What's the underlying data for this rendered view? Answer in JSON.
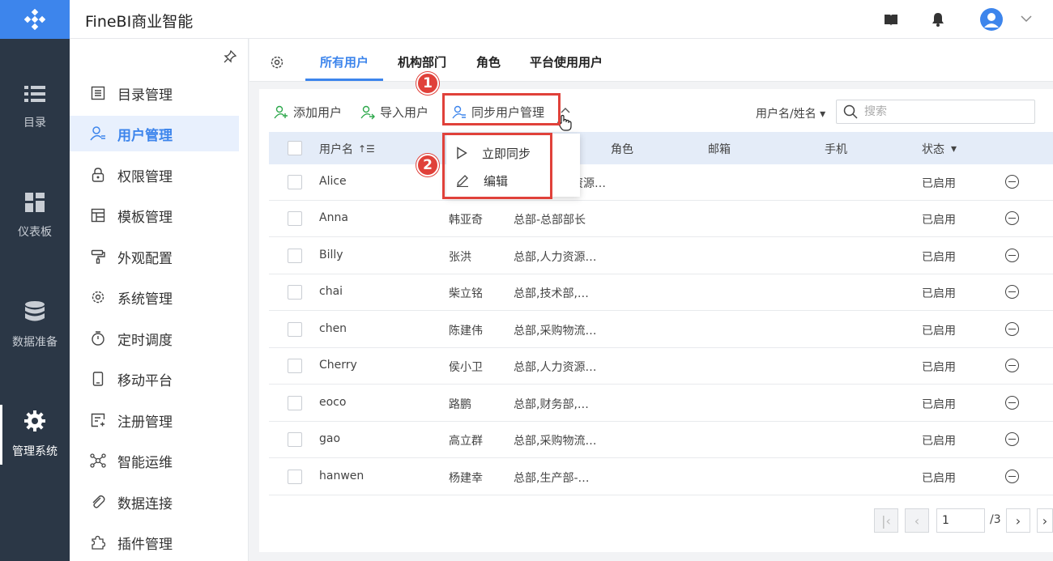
{
  "app": {
    "title": "FineBI商业智能"
  },
  "rail": {
    "items": [
      {
        "label": "目录",
        "icon": "list-icon"
      },
      {
        "label": "仪表板",
        "icon": "dashboard-icon"
      },
      {
        "label": "数据准备",
        "icon": "database-icon"
      },
      {
        "label": "管理系统",
        "icon": "gear-icon"
      }
    ]
  },
  "sidebar": {
    "items": [
      {
        "label": "目录管理",
        "icon": "catalog-icon"
      },
      {
        "label": "用户管理",
        "icon": "user-icon"
      },
      {
        "label": "权限管理",
        "icon": "lock-icon"
      },
      {
        "label": "模板管理",
        "icon": "template-icon"
      },
      {
        "label": "外观配置",
        "icon": "paint-roller-icon"
      },
      {
        "label": "系统管理",
        "icon": "settings-icon"
      },
      {
        "label": "定时调度",
        "icon": "timer-icon"
      },
      {
        "label": "移动平台",
        "icon": "mobile-icon"
      },
      {
        "label": "注册管理",
        "icon": "register-icon"
      },
      {
        "label": "智能运维",
        "icon": "network-icon"
      },
      {
        "label": "数据连接",
        "icon": "paperclip-icon"
      },
      {
        "label": "插件管理",
        "icon": "puzzle-icon"
      }
    ]
  },
  "tabs": [
    "所有用户",
    "机构部门",
    "角色",
    "平台使用用户"
  ],
  "toolbar": {
    "add_user": "添加用户",
    "import_user": "导入用户",
    "sync_manage": "同步用户管理",
    "filter_label": "用户名/姓名",
    "search_placeholder": "搜索"
  },
  "dropdown": {
    "sync_now": "立即同步",
    "edit": "编辑"
  },
  "annotations": {
    "step1": "1",
    "step2": "2"
  },
  "table": {
    "headers": {
      "username": "用户名",
      "role": "角色",
      "email": "邮箱",
      "phone": "手机",
      "status": "状态"
    },
    "rows": [
      {
        "username": "Alice",
        "name": "",
        "dept": "资源…",
        "status": "已启用"
      },
      {
        "username": "Anna",
        "name": "韩亚奇",
        "dept": "总部-总部部长",
        "status": "已启用"
      },
      {
        "username": "Billy",
        "name": "张洪",
        "dept": "总部,人力资源…",
        "status": "已启用"
      },
      {
        "username": "chai",
        "name": "柴立铭",
        "dept": "总部,技术部,…",
        "status": "已启用"
      },
      {
        "username": "chen",
        "name": "陈建伟",
        "dept": "总部,采购物流…",
        "status": "已启用"
      },
      {
        "username": "Cherry",
        "name": "侯小卫",
        "dept": "总部,人力资源…",
        "status": "已启用"
      },
      {
        "username": "eoco",
        "name": "路鹏",
        "dept": "总部,财务部,…",
        "status": "已启用"
      },
      {
        "username": "gao",
        "name": "高立群",
        "dept": "总部,采购物流…",
        "status": "已启用"
      },
      {
        "username": "hanwen",
        "name": "杨建幸",
        "dept": "总部,生产部-…",
        "status": "已启用"
      }
    ]
  },
  "pager": {
    "current": "1",
    "total": "/3"
  },
  "colors": {
    "accent": "#3d85ec",
    "highlight": "#e0413a",
    "rail": "#2b3746"
  }
}
